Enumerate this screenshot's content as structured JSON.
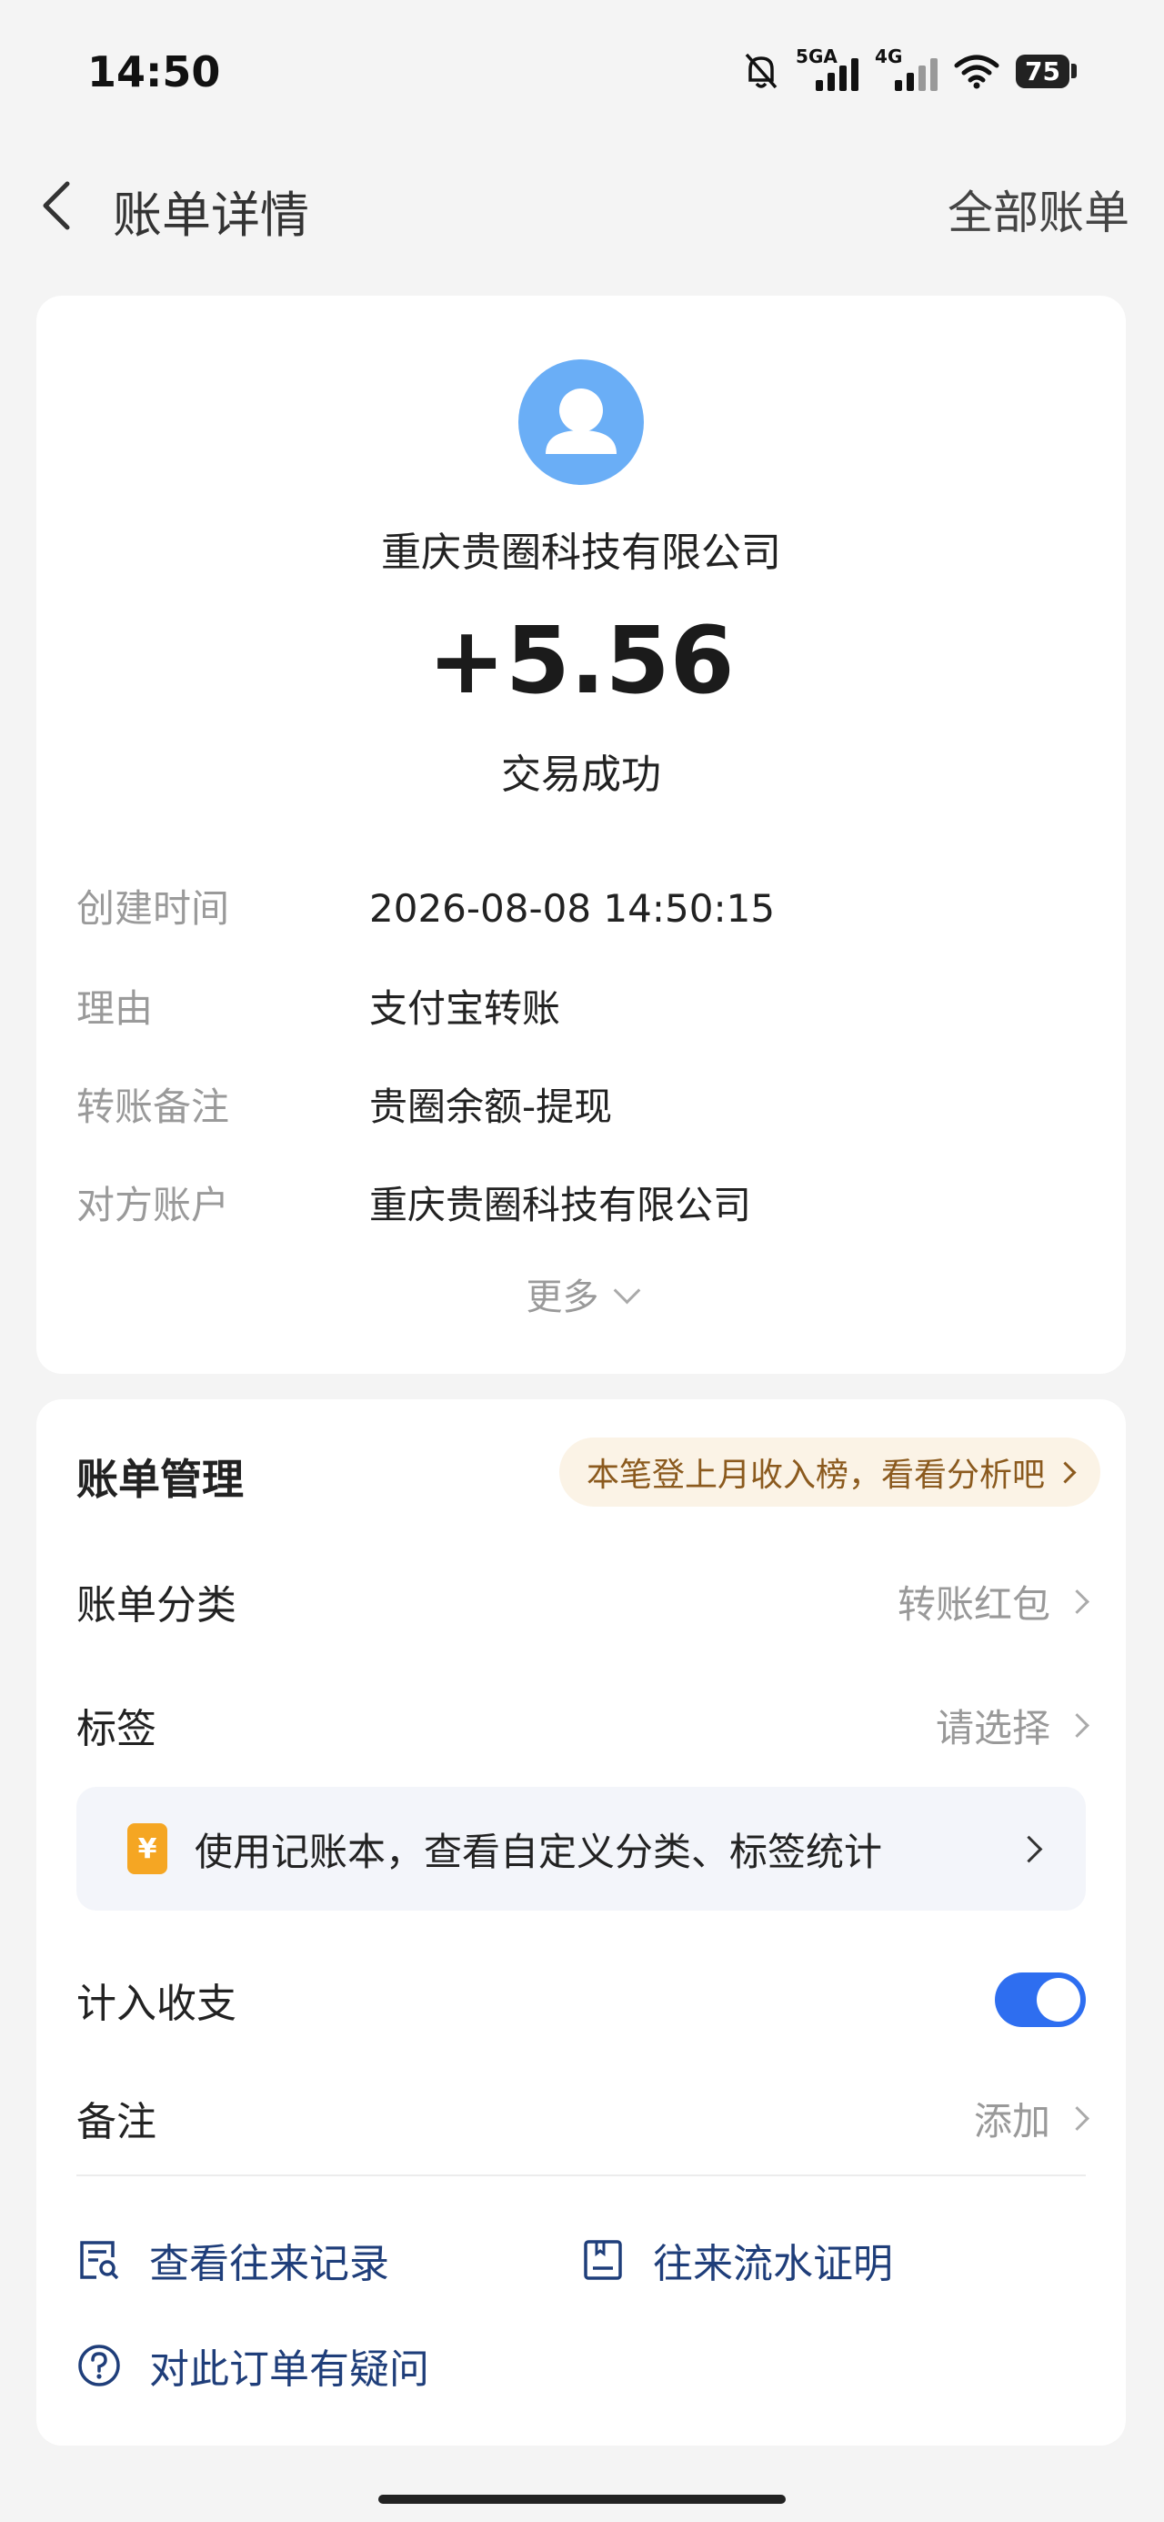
{
  "status_bar": {
    "time": "14:50",
    "sig1_label": "5GA",
    "sig2_label": "4G",
    "battery": "75"
  },
  "header": {
    "title": "账单详情",
    "right_link": "全部账单"
  },
  "transaction": {
    "counterparty": "重庆贵圈科技有限公司",
    "amount": "+5.56",
    "status": "交易成功",
    "details": [
      {
        "key": "创建时间",
        "value": "2026-08-08 14:50:15"
      },
      {
        "key": "理由",
        "value": "支付宝转账"
      },
      {
        "key": "转账备注",
        "value": "贵圈余额-提现"
      },
      {
        "key": "对方账户",
        "value": "重庆贵圈科技有限公司"
      }
    ],
    "more_label": "更多"
  },
  "management": {
    "title": "账单管理",
    "promo": "本笔登上月收入榜，看看分析吧",
    "category_label": "账单分类",
    "category_value": "转账红包",
    "tag_label": "标签",
    "tag_value": "请选择",
    "notebook_icon": "¥",
    "notebook_text": "使用记账本，查看自定义分类、标签统计",
    "include_label": "计入收支",
    "include_enabled": true,
    "note_label": "备注",
    "note_value": "添加",
    "link_history": "查看往来记录",
    "link_proof": "往来流水证明",
    "link_question": "对此订单有疑问"
  },
  "colors": {
    "accent": "#2e6ef0",
    "avatar": "#6aaef6",
    "link": "#1f3e7a"
  }
}
